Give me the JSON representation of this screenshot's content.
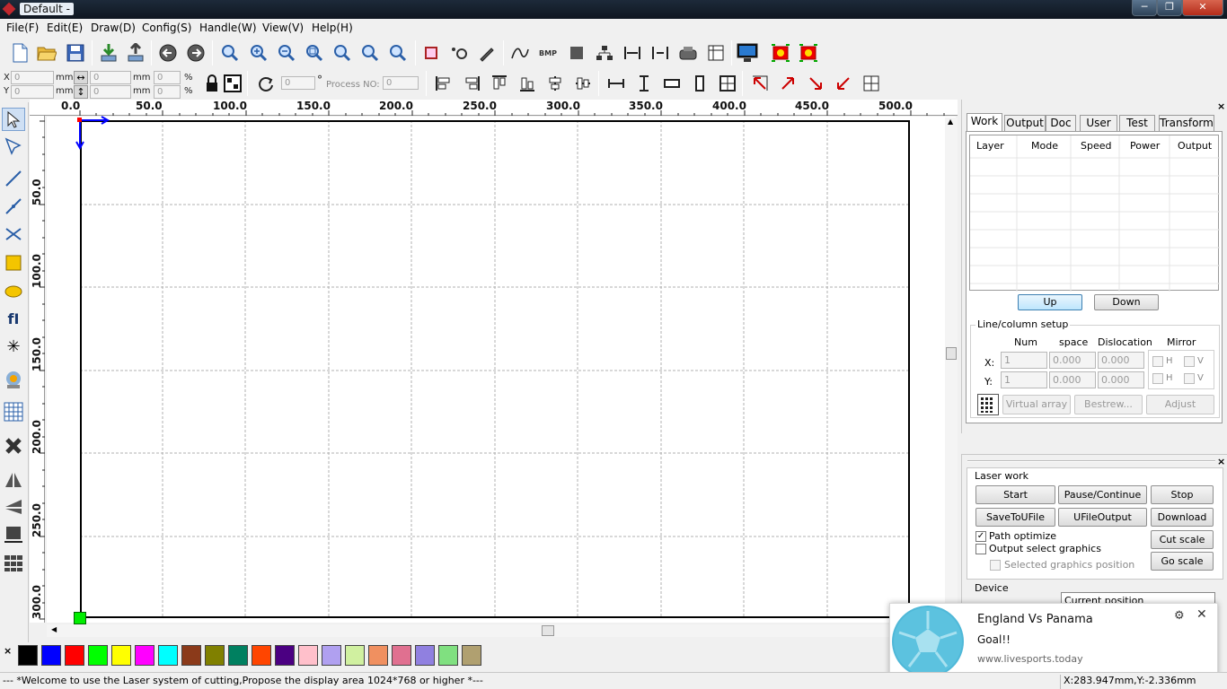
{
  "window": {
    "title": "Default -",
    "min": "─",
    "max": "❐",
    "close": "✕"
  },
  "menu": [
    "File(F)",
    "Edit(E)",
    "Draw(D)",
    "Config(S)",
    "Handle(W)",
    "View(V)",
    "Help(H)"
  ],
  "props": {
    "x_label": "X",
    "y_label": "Y",
    "x_value": "0",
    "y_value": "0",
    "w_value": "0",
    "h_value": "0",
    "x_percent": "0",
    "y_percent": "0",
    "unit_mm": "mm",
    "percent_sign": "%",
    "angle": "0",
    "degree": "°",
    "process_no_label": "Process NO:",
    "process_no": "0"
  },
  "ruler": {
    "h_ticks": [
      "0.0",
      "50.0",
      "100.0",
      "150.0",
      "200.0",
      "250.0",
      "300.0",
      "350.0",
      "400.0",
      "450.0",
      "500.0"
    ],
    "v_ticks": [
      "50.0",
      "100.0",
      "150.0",
      "200.0",
      "250.0",
      "300.0"
    ]
  },
  "palette": [
    "#000000",
    "#0000ff",
    "#ff0000",
    "#00ff00",
    "#ffff00",
    "#ff00ff",
    "#00ffff",
    "#8b3a1a",
    "#808000",
    "#008060",
    "#ff4500",
    "#4b0082",
    "#ffc0cb",
    "#b0a0f0",
    "#d0f0a0",
    "#f09060",
    "#e07090",
    "#9080e0",
    "#80e080",
    "#b0a070"
  ],
  "work_panel": {
    "tabs": [
      "Work",
      "Output",
      "Doc",
      "User",
      "Test",
      "Transform"
    ],
    "active_tab": "Work",
    "columns": [
      "Layer",
      "Mode",
      "Speed",
      "Power",
      "Output"
    ],
    "up": "Up",
    "down": "Down",
    "line_setup": {
      "title": "Line/column setup",
      "num": "Num",
      "space": "space",
      "dislocation": "Dislocation",
      "mirror": "Mirror",
      "x_label": "X:",
      "y_label": "Y:",
      "x_num": "1",
      "x_space": "0.000",
      "x_disl": "0.000",
      "y_num": "1",
      "y_space": "0.000",
      "y_disl": "0.000",
      "h": "H",
      "v": "V",
      "virtual_array": "Virtual array",
      "bestrew": "Bestrew...",
      "adjust": "Adjust"
    }
  },
  "laser_work": {
    "title": "Laser work",
    "start": "Start",
    "pause": "Pause/Continue",
    "stop": "Stop",
    "save_ufile": "SaveToUFile",
    "ufile_output": "UFileOutput",
    "download": "Download",
    "path_optimize": "Path optimize",
    "output_select": "Output select graphics",
    "selected_pos": "Selected graphics position",
    "cut_scale": "Cut scale",
    "go_scale": "Go scale",
    "device": "Device",
    "position_select": "Current position"
  },
  "toast": {
    "title": "England Vs Panama",
    "body": "Goal!!",
    "source": "www.livesports.today"
  },
  "status": {
    "message": "--- *Welcome to use the Laser system of cutting,Propose the display area 1024*768 or higher *---",
    "coords": "X:283.947mm,Y:-2.336mm"
  }
}
